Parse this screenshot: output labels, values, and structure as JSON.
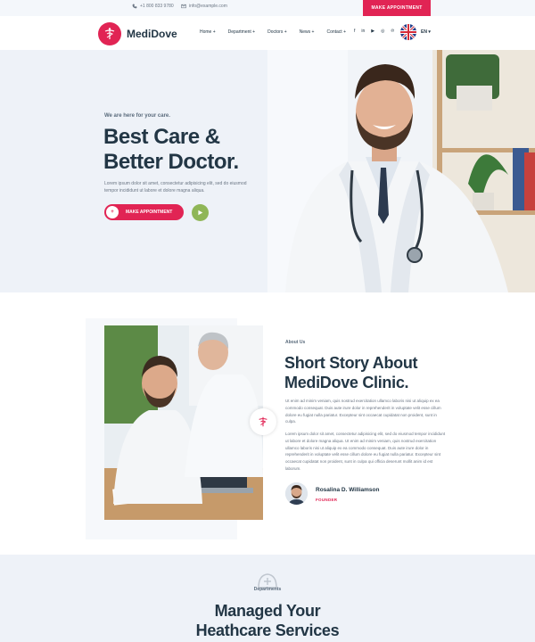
{
  "topbar": {
    "phone": "+1 800 833 9780",
    "email": "info@example.com",
    "cta": "MAKE APPOINTMENT"
  },
  "header": {
    "logo_text": "MediDove",
    "nav": [
      {
        "label": "Home +"
      },
      {
        "label": "Department +"
      },
      {
        "label": "Doctors +"
      },
      {
        "label": "News +"
      },
      {
        "label": "Contact +"
      }
    ],
    "socials": [
      {
        "icon": "facebook-icon",
        "glyph": "f"
      },
      {
        "icon": "linkedin-icon",
        "glyph": "in"
      },
      {
        "icon": "youtube-icon",
        "glyph": "▶"
      },
      {
        "icon": "instagram-icon",
        "glyph": "◎"
      },
      {
        "icon": "pinterest-icon",
        "glyph": "℗"
      }
    ],
    "language": "EN ▾"
  },
  "hero": {
    "tagline": "We are here for your care.",
    "title_line1": "Best Care &",
    "title_line2": "Better Doctor.",
    "text": "Lorem ipsum dolor sit amet, consectetur adipisicing elit, sed do eiusmod tempor incididunt ut labore et dolore magna aliqua.",
    "button_label": "MAKE APPOINTMENT"
  },
  "about": {
    "label": "About Us",
    "title_line1": "Short Story About",
    "title_line2": "MediDove Clinic.",
    "p1": "Ut enim ad minim veniam, quis nostrud exercitation ullamco laboris nisi ut aliquip ex ea commodo consequat. Duis aute irure dolor in reprehenderit in voluptate velit esse cillum dolore eu fugiat nulla pariatur. Excepteur sint occaecat cupidatat non proident, sunt in culpa.",
    "p2": "Lorem ipsum dolor sit amet, consectetur adipisicing elit, sed do eiusmod tempor incididunt ut labore et dolore magna aliqua. Ut enim ad minim veniam, quis nostrud exercitation ullamco laboris nisi ut aliquip ex ea commodo consequat. Duis aute irure dolor in reprehenderit in voluptate velit esse cillum dolore eu fugiat nulla pariatur. Excepteur sint occaecat cupidatat non proident, sunt in culpa qui officia deserunt mollit anim id est laborum.",
    "author_name": "Rosalina D. Williamson",
    "author_role": "FOUNDER"
  },
  "departments": {
    "label": "Departments",
    "title_line1": "Managed Your",
    "title_line2": "Heathcare Services"
  },
  "colors": {
    "accent": "#e12454",
    "heading": "#223645",
    "green": "#8fb657",
    "light_bg": "#eef2f8"
  }
}
